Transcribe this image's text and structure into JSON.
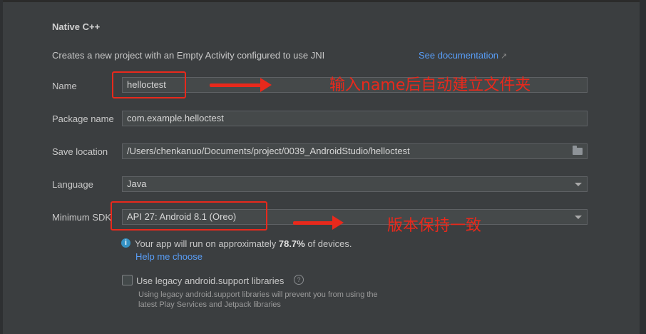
{
  "header": {
    "title": "Native C++",
    "description": "Creates a new project with an Empty Activity configured to use JNI",
    "doc_link": "See documentation",
    "doc_link_icon": "external-link-icon"
  },
  "form": {
    "name": {
      "label": "Name",
      "value": "helloctest"
    },
    "package": {
      "label": "Package name",
      "value": "com.example.helloctest"
    },
    "save_location": {
      "label": "Save location",
      "value": "/Users/chenkanuo/Documents/project/0039_AndroidStudio/helloctest",
      "icon": "folder-icon"
    },
    "language": {
      "label": "Language",
      "value": "Java"
    },
    "min_sdk": {
      "label": "Minimum SDK",
      "value": "API 27: Android 8.1 (Oreo)"
    }
  },
  "sdk_info": {
    "icon": "info-icon",
    "text_before": "Your app will run on approximately ",
    "percent": "78.7%",
    "text_after": " of devices.",
    "help_link": "Help me choose"
  },
  "legacy": {
    "label": "Use legacy android.support libraries",
    "checked": false,
    "help_icon": "question-icon",
    "note_line1": "Using legacy android.support libraries will prevent you from using the",
    "note_line2": "latest Play Services and Jetpack libraries"
  },
  "annotations": {
    "name_note": "输入name后自动建立文件夹",
    "sdk_note": "版本保持一致",
    "color": "#e8291c"
  }
}
